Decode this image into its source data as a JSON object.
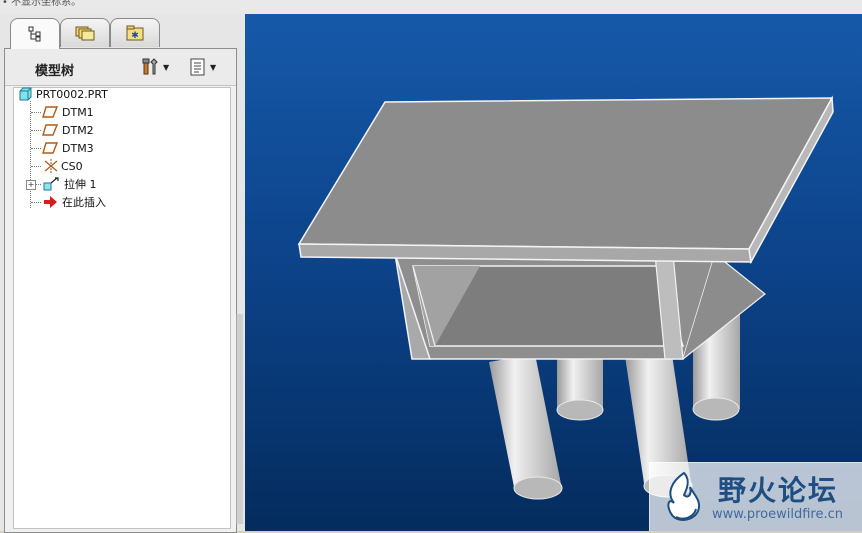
{
  "status_message": "• 不显示坐标系。",
  "tabs": [
    {
      "name": "model-tree-tab",
      "icon": "model-tree-icon"
    },
    {
      "name": "folder-browser-tab",
      "icon": "folder-icon"
    },
    {
      "name": "favorites-tab",
      "icon": "favorites-icon"
    }
  ],
  "panel": {
    "title": "模型树",
    "settings_icon": "tools-icon",
    "show_icon": "list-icon"
  },
  "tree": {
    "root": "PRT0002.PRT",
    "items": [
      {
        "label": "DTM1",
        "icon": "datum-plane-icon"
      },
      {
        "label": "DTM2",
        "icon": "datum-plane-icon"
      },
      {
        "label": "DTM3",
        "icon": "datum-plane-icon"
      },
      {
        "label": "CS0",
        "icon": "coordinate-system-icon"
      },
      {
        "label": "拉伸 1",
        "icon": "extrude-icon",
        "expandable": true
      },
      {
        "label": "在此插入",
        "icon": "insert-arrow-icon"
      }
    ]
  },
  "watermark": {
    "title": "野火论坛",
    "url": "www.proewildfire.cn"
  },
  "colors": {
    "viewport_top": "#1659a9",
    "viewport_bottom": "#042c5d",
    "model_face": "#8c8c8c",
    "model_edge": "#f2f2f2"
  }
}
